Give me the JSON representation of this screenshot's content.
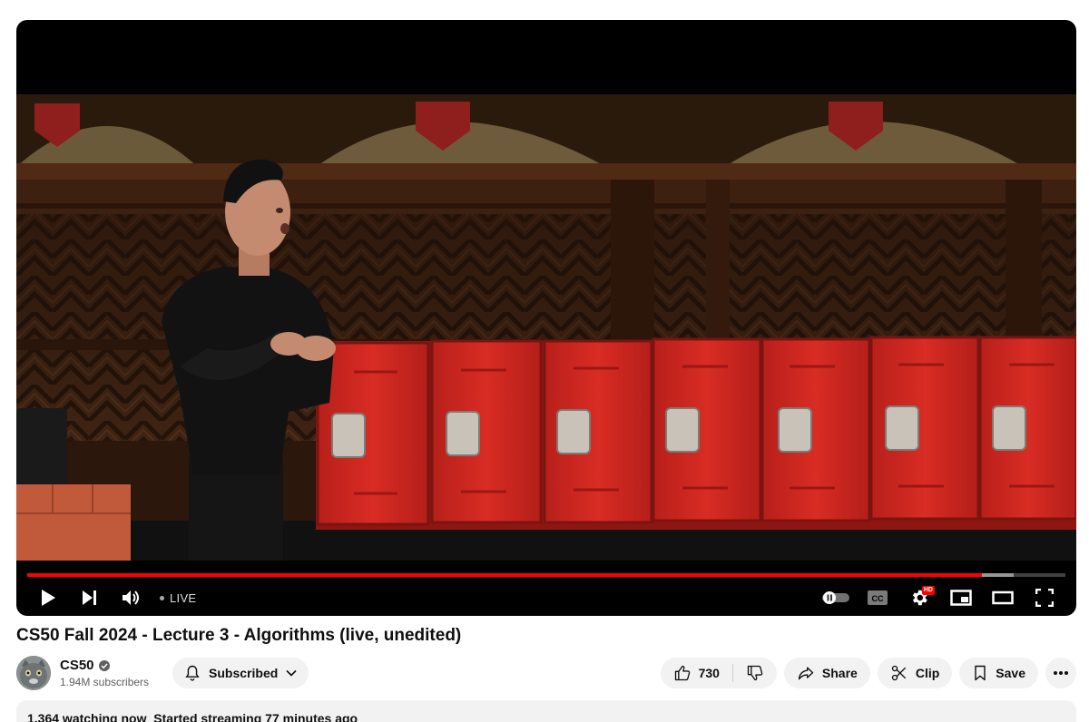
{
  "player": {
    "live_label": "LIVE",
    "progress_played": 0.92,
    "progress_loaded": 0.95,
    "hd_badge": "HD",
    "cc_label": "CC",
    "icons": [
      "play-icon",
      "next-icon",
      "volume-icon",
      "autoplay-toggle-icon",
      "captions-icon",
      "settings-icon",
      "miniplayer-icon",
      "theater-icon",
      "fullscreen-icon"
    ]
  },
  "video": {
    "title": "CS50 Fall 2024 - Lecture 3 - Algorithms (live, unedited)"
  },
  "channel": {
    "name": "CS50",
    "subscribers": "1.94M subscribers",
    "subscribe_label": "Subscribed"
  },
  "actions": {
    "likes": "730",
    "share": "Share",
    "clip": "Clip",
    "save": "Save"
  },
  "description": {
    "status": "1,364 watching now  Started streaming 77 minutes ago"
  },
  "colors": {
    "accent": "#ff0000",
    "chip_bg": "#f2f2f2",
    "locker_red": "#d42a22"
  }
}
